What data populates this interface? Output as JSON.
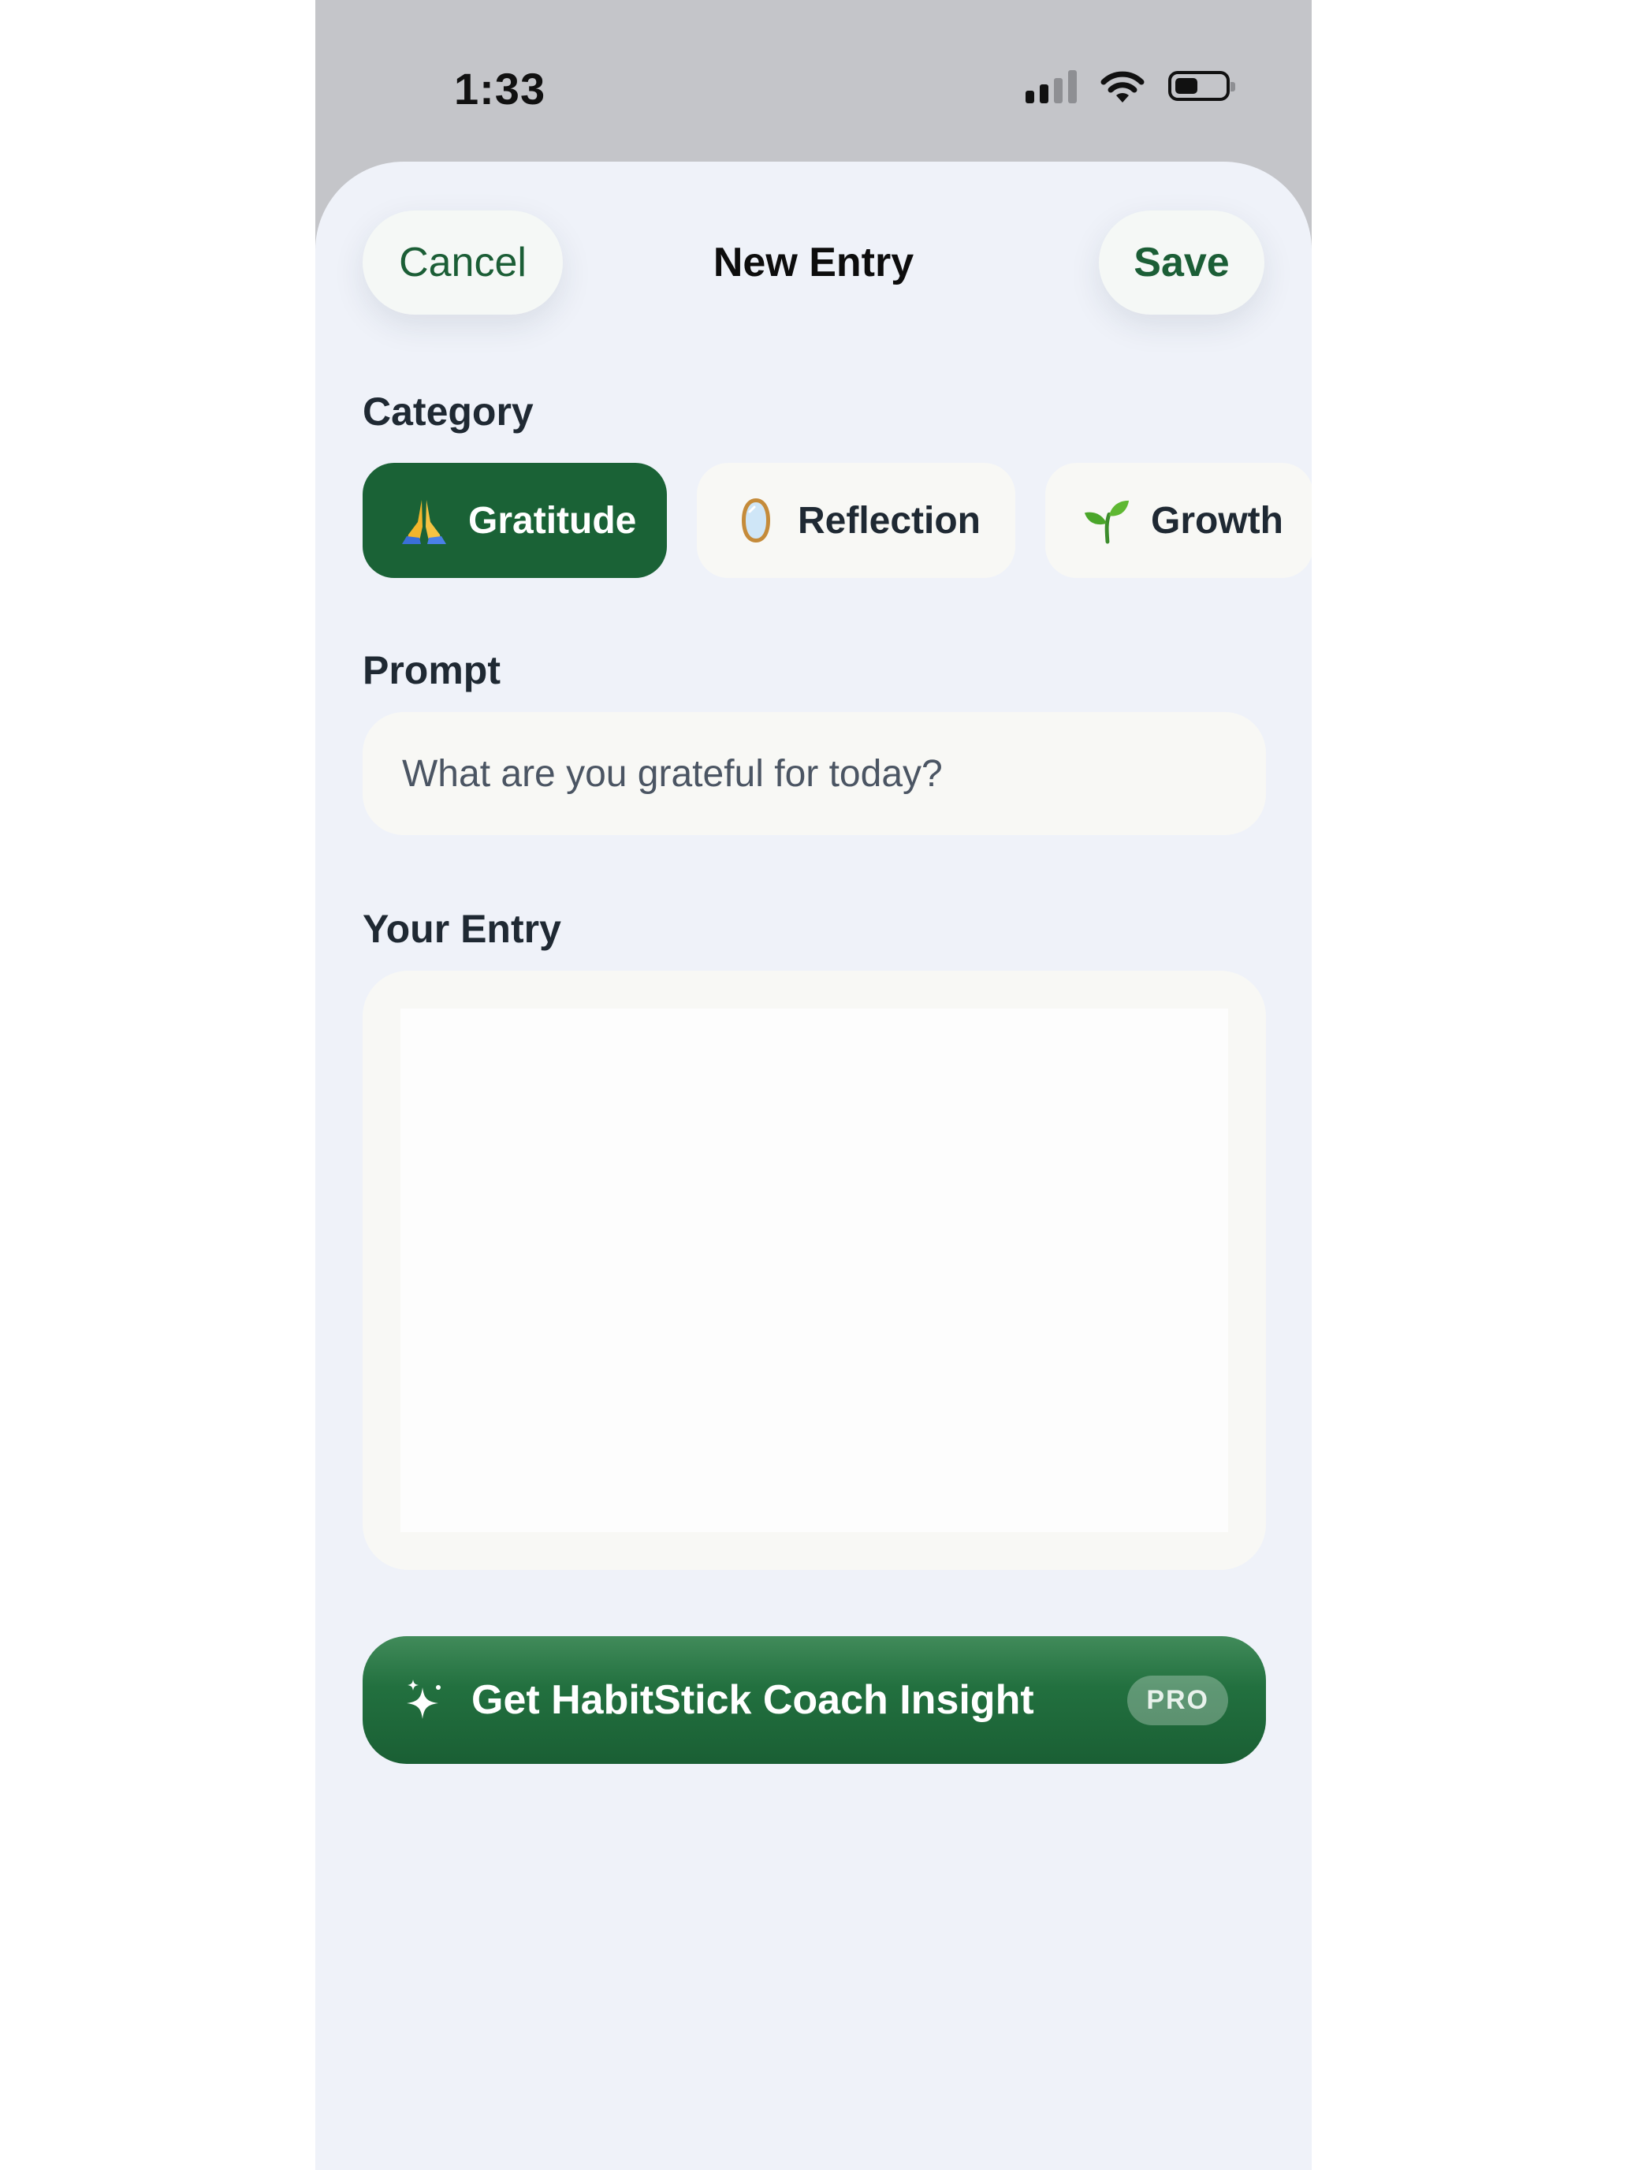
{
  "status_bar": {
    "time": "1:33"
  },
  "nav": {
    "cancel_label": "Cancel",
    "title": "New Entry",
    "save_label": "Save"
  },
  "category": {
    "label": "Category",
    "chips": [
      {
        "label": "Gratitude",
        "icon": "praying-hands-icon",
        "selected": true
      },
      {
        "label": "Reflection",
        "icon": "mirror-icon",
        "selected": false
      },
      {
        "label": "Growth",
        "icon": "seedling-icon",
        "selected": false
      }
    ]
  },
  "prompt": {
    "label": "Prompt",
    "value": "What are you grateful for today?"
  },
  "entry": {
    "label": "Your Entry",
    "value": ""
  },
  "coach": {
    "label": "Get HabitStick Coach Insight",
    "badge": "PRO",
    "icon": "sparkles-icon"
  },
  "colors": {
    "accent": "#1a6236",
    "sheet_background": "#eff2f9",
    "field_background": "#f8f8f5"
  }
}
